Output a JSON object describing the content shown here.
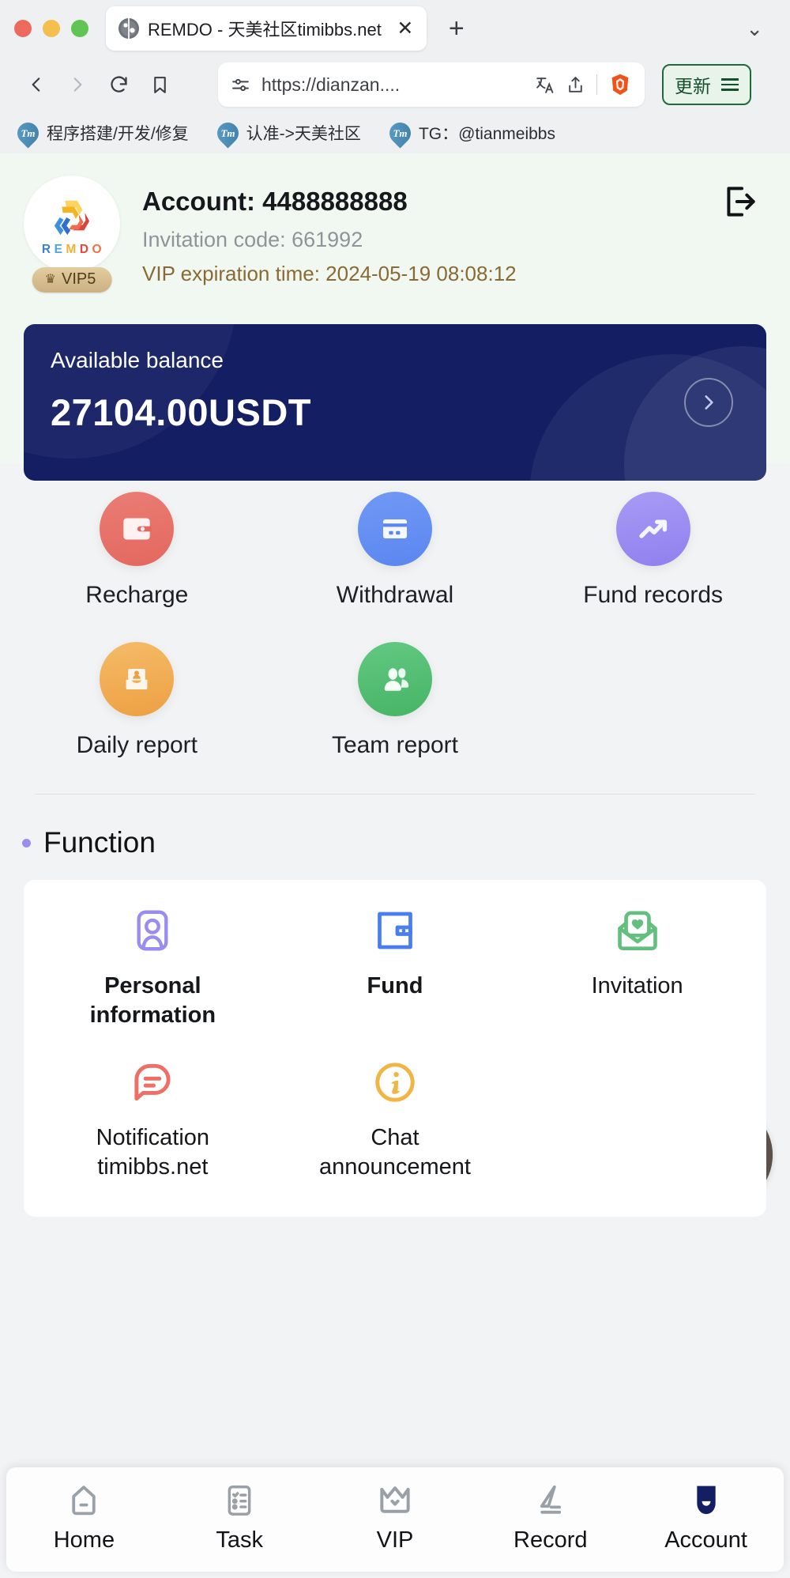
{
  "browser": {
    "tab": {
      "title": "REMDO - 天美社区timibbs.net",
      "close_label": "✕",
      "favicon": "globe-icon"
    },
    "newtab_label": "+",
    "tablist_chevron": "⌄",
    "url": "https://dianzan....",
    "update_button": "更新",
    "bookmarks": [
      {
        "label": "程序搭建/开发/修复",
        "icon": "tm-icon",
        "icon_text": "Tm"
      },
      {
        "label": "认准->天美社区",
        "icon": "tm-icon",
        "icon_text": "Tm"
      },
      {
        "label": "TG：@tianmeibbs",
        "icon": "tm-icon",
        "icon_text": "Tm"
      }
    ]
  },
  "account": {
    "brand_letters": [
      "R",
      "E",
      "M",
      "D",
      "O"
    ],
    "brand_colors": [
      "#3f7fd6",
      "#4fa3e8",
      "#f2b134",
      "#e8453c",
      "#f2703f"
    ],
    "vip_badge": "VIP5",
    "vip_crown": "♛",
    "account_label": "Account: 4488888888",
    "invitation_label": "Invitation code: 661992",
    "vip_expiration_label": "VIP expiration time: 2024-05-19 08:08:12",
    "logout_icon": "logout-icon"
  },
  "balance": {
    "label": "Available balance",
    "amount": "27104.00USDT",
    "card_color": "#141f63",
    "arrow_icon": "chevron-right-icon"
  },
  "quick_actions": [
    {
      "label": "Recharge",
      "icon": "wallet-icon",
      "color": "#e8736b"
    },
    {
      "label": "Withdrawal",
      "icon": "credit-card-icon",
      "color": "#6690f2"
    },
    {
      "label": "Fund records",
      "icon": "trending-up-icon",
      "color": "#9b8df0"
    },
    {
      "label": "Daily report",
      "icon": "inbox-person-icon",
      "color": "#f0ad4d"
    },
    {
      "label": "Team report",
      "icon": "team-icon",
      "color": "#4fbf73"
    }
  ],
  "function": {
    "title": "Function",
    "bullet_color": "#9b8df0",
    "items": [
      {
        "label": "Personal information",
        "icon": "person-card-icon",
        "color": "#9b8df0",
        "bold": true
      },
      {
        "label": "Fund",
        "icon": "wallet-outline-icon",
        "color": "#4a7ef0",
        "bold": true
      },
      {
        "label": "Invitation",
        "icon": "envelope-heart-icon",
        "color": "#62bf7e",
        "bold": false
      },
      {
        "label": "Notification timibbs.net",
        "icon": "speech-bubble-icon",
        "color": "#ed6f66",
        "bold": false
      },
      {
        "label": "Chat announcement",
        "icon": "info-circle-icon",
        "color": "#f0b544",
        "bold": false
      }
    ],
    "service_avatar": "customer-service-avatar"
  },
  "bottom_nav": {
    "items": [
      {
        "label": "Home",
        "icon": "home-icon",
        "active": false
      },
      {
        "label": "Task",
        "icon": "checklist-icon",
        "active": false
      },
      {
        "label": "VIP",
        "icon": "crown-icon",
        "active": false
      },
      {
        "label": "Record",
        "icon": "pencil-icon",
        "active": false
      },
      {
        "label": "Account",
        "icon": "account-icon",
        "active": true
      }
    ],
    "active_color": "#141f63",
    "inactive_color": "#9aa0a8"
  }
}
